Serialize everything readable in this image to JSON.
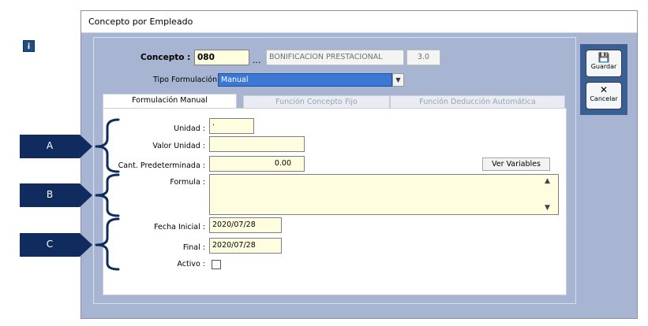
{
  "window": {
    "title": "Concepto por Empleado"
  },
  "concepto": {
    "label": "Concepto :",
    "code": "080",
    "ellipsis": "...",
    "description": "BONIFICACION PRESTACIONAL",
    "version": "3.0"
  },
  "tipo_formulacion": {
    "label": "Tipo Formulación",
    "selected": "Manual"
  },
  "tabs": [
    {
      "label": "Formulación Manual",
      "active": true
    },
    {
      "label": "Función Concepto Fijo",
      "active": false
    },
    {
      "label": "Función Deducción Automática",
      "active": false
    }
  ],
  "form": {
    "unidad_label": "Unidad :",
    "unidad_value": "·",
    "valor_unidad_label": "Valor Unidad :",
    "valor_unidad_value": "",
    "cant_label": "Cant. Predeterminada :",
    "cant_value": "0.00",
    "ver_variables_label": "Ver Variables",
    "formula_label": "Formula :",
    "formula_value": "",
    "fecha_inicial_label": "Fecha Inicial :",
    "fecha_inicial_value": "2020/07/28",
    "final_label": "Final :",
    "final_value": "2020/07/28",
    "activo_label": "Activo :",
    "activo_checked": false
  },
  "toolbar": {
    "guardar_label": "Guardar",
    "cancelar_label": "Cancelar"
  },
  "callouts": [
    "A",
    "B",
    "C"
  ]
}
